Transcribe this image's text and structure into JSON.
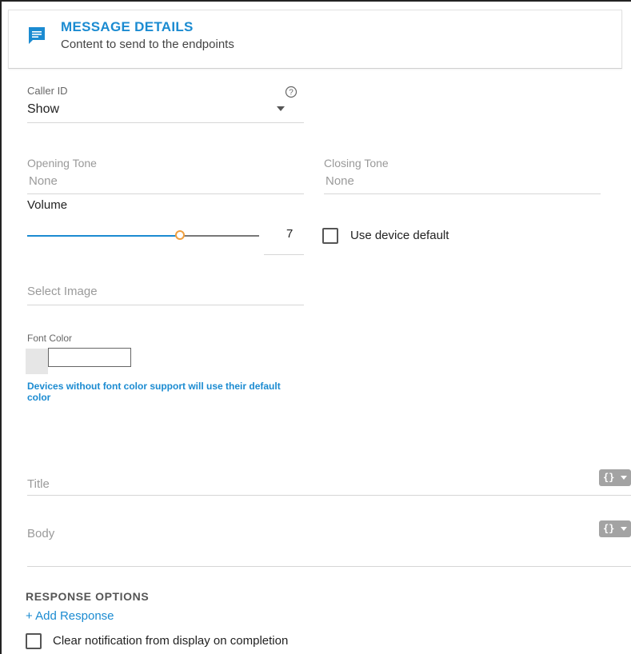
{
  "header": {
    "title": "MESSAGE DETAILS",
    "subtitle": "Content to send to the endpoints",
    "icon": "message-icon",
    "accent": "#1b8bd1"
  },
  "caller_id": {
    "label": "Caller ID",
    "value": "Show",
    "help_icon": "help-icon"
  },
  "opening_tone": {
    "label": "Opening Tone",
    "value": "None"
  },
  "closing_tone": {
    "label": "Closing Tone",
    "value": "None"
  },
  "volume": {
    "label": "Volume",
    "value": "7",
    "level_fraction": 0.66,
    "use_device_default_label": "Use device default",
    "use_device_default_checked": false
  },
  "image": {
    "placeholder": "Select Image"
  },
  "font_color": {
    "label": "Font Color",
    "hint": "Devices without font color support will use their default color"
  },
  "title_field": {
    "placeholder": "Title",
    "var_button": "{}"
  },
  "body_field": {
    "placeholder": "Body",
    "var_button": "{}"
  },
  "response_options": {
    "title": "RESPONSE OPTIONS",
    "add_label": "+ Add Response",
    "clear_label": "Clear notification from display on completion",
    "clear_checked": false
  }
}
